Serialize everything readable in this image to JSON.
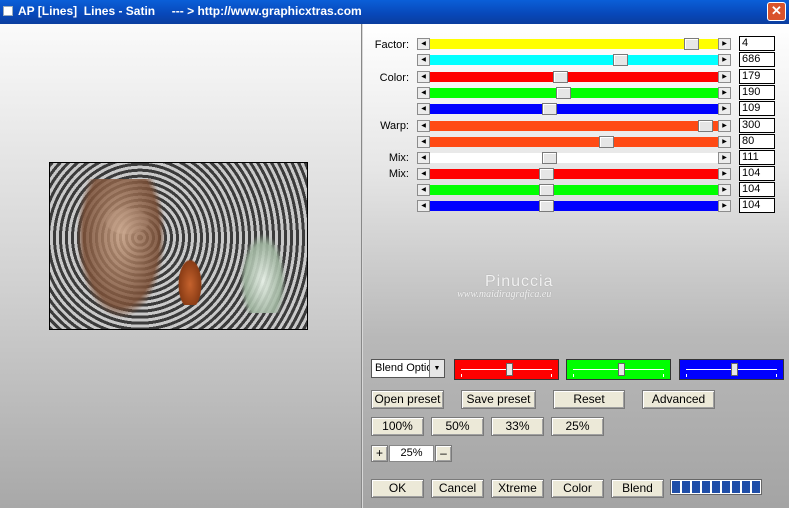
{
  "window": {
    "title": "AP [Lines]  Lines - Satin     --- > http://www.graphicxtras.com",
    "close_glyph": "✕"
  },
  "sliders": [
    {
      "label": "Factor:",
      "color": "#ffff00",
      "value": "4",
      "fraction": 0.93
    },
    {
      "label": "",
      "color": "#00ffff",
      "value": "686",
      "fraction": 0.67
    },
    {
      "label": "Color:",
      "color": "#ff0000",
      "value": "179",
      "fraction": 0.45
    },
    {
      "label": "",
      "color": "#00ff00",
      "value": "190",
      "fraction": 0.46
    },
    {
      "label": "",
      "color": "#0000ff",
      "value": "109",
      "fraction": 0.41
    },
    {
      "label": "Warp:",
      "color": "#ff4a14",
      "value": "300",
      "fraction": 0.98
    },
    {
      "label": "",
      "color": "#ff4a14",
      "value": "80",
      "fraction": 0.62
    },
    {
      "label": "Mix:",
      "color": "#ffffff",
      "value": "111",
      "fraction": 0.41
    },
    {
      "label": "Mix:",
      "color": "#ff0000",
      "value": "104",
      "fraction": 0.4
    },
    {
      "label": "",
      "color": "#00ff00",
      "value": "104",
      "fraction": 0.4
    },
    {
      "label": "",
      "color": "#0000ff",
      "value": "104",
      "fraction": 0.4
    }
  ],
  "watermark": {
    "line1": "Pinuccia",
    "line2": "www.maidiragrafica.eu"
  },
  "blend_select": {
    "value": "Blend Optio",
    "arrow_glyph": "▼"
  },
  "color_boxes": [
    {
      "name": "red",
      "color": "#ff0000",
      "fraction": 0.52
    },
    {
      "name": "green",
      "color": "#00ff00",
      "fraction": 0.52
    },
    {
      "name": "blue",
      "color": "#0000ff",
      "fraction": 0.52
    }
  ],
  "buttons": {
    "open_preset": "Open preset",
    "save_preset": "Save preset",
    "reset": "Reset",
    "advanced": "Advanced",
    "z100": "100%",
    "z50": "50%",
    "z33": "33%",
    "z25": "25%",
    "zoom_in": "+",
    "zoom_out": "–",
    "ok": "OK",
    "cancel": "Cancel",
    "xtreme": "Xtreme",
    "color": "Color",
    "blend": "Blend"
  },
  "zoom_value": "25%",
  "progress": {
    "segments_filled": 9
  }
}
